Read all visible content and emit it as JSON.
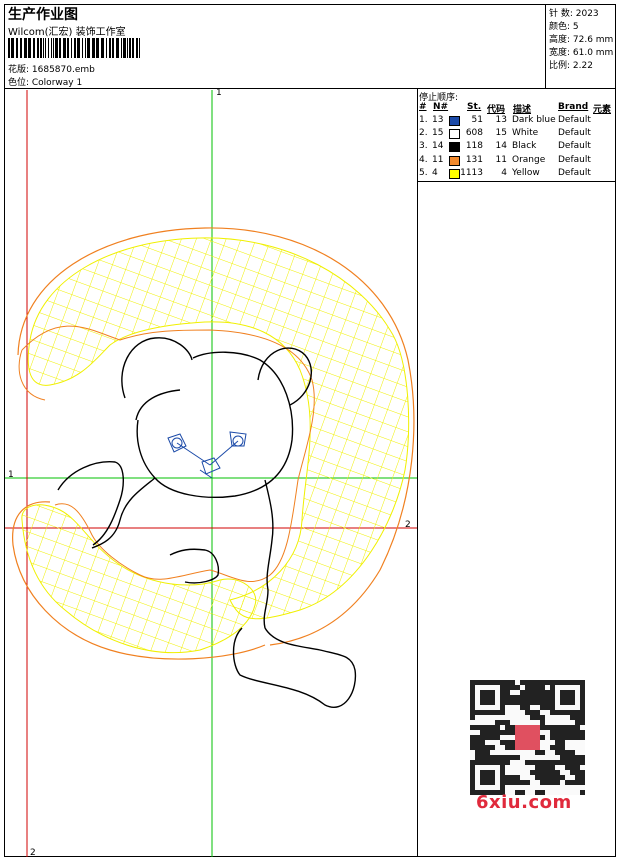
{
  "header": {
    "title": "生产作业图",
    "company": "Wilcom(汇宏) 装饰工作室",
    "design_label": "花版: 1685870.emb",
    "colorway_label": "色位: Colorway 1"
  },
  "stats": [
    {
      "text": "针 数: 2023"
    },
    {
      "text": "颜色: 5"
    },
    {
      "text": "高度: 72.6 mm"
    },
    {
      "text": "宽度: 61.0 mm"
    },
    {
      "text": "比例: 2.22"
    }
  ],
  "stop_sequence": {
    "title": "停止顺序:",
    "headers": {
      "index": "#",
      "needle": "N#",
      "stitches": "St.",
      "code": "代码",
      "description": "描述",
      "brand": "Brand",
      "element": "元素"
    },
    "rows": [
      {
        "index": "1.",
        "needle": "13",
        "color": "#1b4aa8",
        "stitches": "51",
        "code": "13",
        "description": "Dark blue",
        "brand": "Default"
      },
      {
        "index": "2.",
        "needle": "15",
        "color": "#ffffff",
        "stitches": "608",
        "code": "15",
        "description": "White",
        "brand": "Default"
      },
      {
        "index": "3.",
        "needle": "14",
        "color": "#000000",
        "stitches": "118",
        "code": "14",
        "description": "Black",
        "brand": "Default"
      },
      {
        "index": "4.",
        "needle": "11",
        "color": "#f28a2e",
        "stitches": "131",
        "code": "11",
        "description": "Orange",
        "brand": "Default"
      },
      {
        "index": "5.",
        "needle": "4",
        "color": "#ffff00",
        "stitches": "1113",
        "code": "4",
        "description": "Yellow",
        "brand": "Default"
      }
    ]
  },
  "axes": {
    "green_top": "1",
    "green_left": "1",
    "red_right": "2",
    "red_bottom": "2"
  },
  "colors": {
    "guide_green": "#00c000",
    "guide_red": "#d00000",
    "fill_yellow": "#f0f000",
    "outline_orange": "#f08020"
  },
  "watermark": {
    "text": "6xiu.com"
  }
}
